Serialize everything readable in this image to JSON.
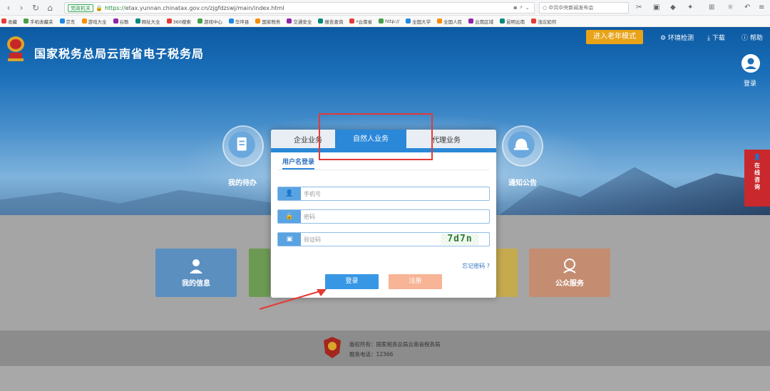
{
  "browser": {
    "secure_badge": "党政机关",
    "url_protocol": "https://",
    "url_rest": "etax.yunnan.chinatax.gov.cn/zjgfdzswj/main/index.html",
    "news_search": "中共中央新闻发布会",
    "bookmarks": [
      "收藏",
      "手机收藏夹",
      "京东",
      "游戏大全",
      "谷歌",
      "网址大全",
      "360搜索",
      "游戏中心",
      "华坪县",
      "国家税务",
      "交通安全",
      "报告查询",
      "*云南省",
      "http://",
      "全国大学",
      "全国人民",
      "云南区域",
      "昆明云南",
      "浅议如何"
    ]
  },
  "header": {
    "site_title": "国家税务总局云南省电子税务局",
    "elder_mode": "进入老年模式",
    "env_check": "环境检测",
    "download": "下载",
    "help": "帮助",
    "login": "登录"
  },
  "quick_links": {
    "todo": "我的待办",
    "notice": "通知公告"
  },
  "online_consult": "在线咨询",
  "cards": {
    "my_info": "我的信息",
    "public_service": "公众服务"
  },
  "modal": {
    "tabs": [
      "企业业务",
      "自然人业务",
      "代理业务"
    ],
    "subtab": "用户名登录",
    "phone_placeholder": "手机号",
    "password_placeholder": "密码",
    "captcha_placeholder": "验证码",
    "captcha_text": "7d7n",
    "forgot": "忘记密码 ?",
    "login_btn": "登录",
    "register_btn": "注册"
  },
  "footer": {
    "copyright": "版权所有：国家税务总局云南省税务局",
    "phone": "服务电话：12366"
  },
  "colors": {
    "accent_blue": "#2b88d8",
    "elder_orange": "#e8a318",
    "annotation_red": "#e53935"
  }
}
